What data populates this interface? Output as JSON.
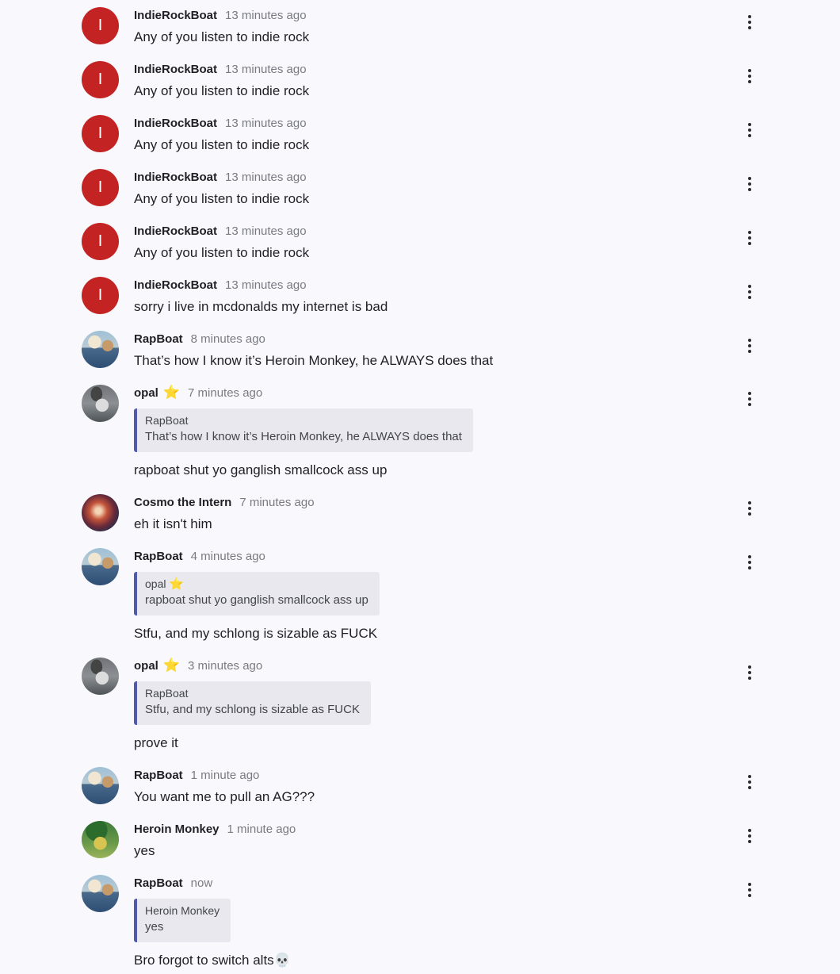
{
  "messages": [
    {
      "author": "IndieRockBoat",
      "time": "13 minutes ago",
      "text": "Any of you listen to indie rock",
      "avatar_letter": "I"
    },
    {
      "author": "IndieRockBoat",
      "time": "13 minutes ago",
      "text": "Any of you listen to indie rock",
      "avatar_letter": "I"
    },
    {
      "author": "IndieRockBoat",
      "time": "13 minutes ago",
      "text": "Any of you listen to indie rock",
      "avatar_letter": "I"
    },
    {
      "author": "IndieRockBoat",
      "time": "13 minutes ago",
      "text": "Any of you listen to indie rock",
      "avatar_letter": "I"
    },
    {
      "author": "IndieRockBoat",
      "time": "13 minutes ago",
      "text": "Any of you listen to indie rock",
      "avatar_letter": "I"
    },
    {
      "author": "IndieRockBoat",
      "time": "13 minutes ago",
      "text": "sorry i live in mcdonalds my internet is bad",
      "avatar_letter": "I"
    },
    {
      "author": "RapBoat",
      "time": "8 minutes ago",
      "text": "That’s how I know it’s Heroin Monkey, he ALWAYS does that"
    },
    {
      "author": "opal",
      "badge": "⭐",
      "time": "7 minutes ago",
      "quote": {
        "author": "RapBoat",
        "text": "That’s how I know it’s Heroin Monkey, he ALWAYS does that"
      },
      "text": "rapboat shut yo ganglish smallcock ass up"
    },
    {
      "author": "Cosmo the Intern",
      "time": "7 minutes ago",
      "text": "eh it isn't him"
    },
    {
      "author": "RapBoat",
      "time": "4 minutes ago",
      "quote": {
        "author": "opal",
        "badge": "⭐",
        "text": "rapboat shut yo ganglish smallcock ass up"
      },
      "text": "Stfu, and my schlong is sizable as FUCK"
    },
    {
      "author": "opal",
      "badge": "⭐",
      "time": "3 minutes ago",
      "quote": {
        "author": "RapBoat",
        "text": "Stfu, and my schlong is sizable as FUCK"
      },
      "text": "prove it"
    },
    {
      "author": "RapBoat",
      "time": "1 minute ago",
      "text": "You want me to pull an AG???"
    },
    {
      "author": "Heroin Monkey",
      "time": "1 minute ago",
      "text": "yes"
    },
    {
      "author": "RapBoat",
      "time": "now",
      "quote": {
        "author": "Heroin Monkey",
        "text": "yes"
      },
      "text": "Bro forgot to switch alts💀"
    }
  ],
  "colors": {
    "background": "#f8f8fd",
    "letter_avatar": "#c42323",
    "quote_bar": "#4f5aa8",
    "quote_bg": "#e8e8ee",
    "star": "#f5c518"
  },
  "icons": {
    "menu": "kebab-menu-icon",
    "badge": "star-icon"
  }
}
